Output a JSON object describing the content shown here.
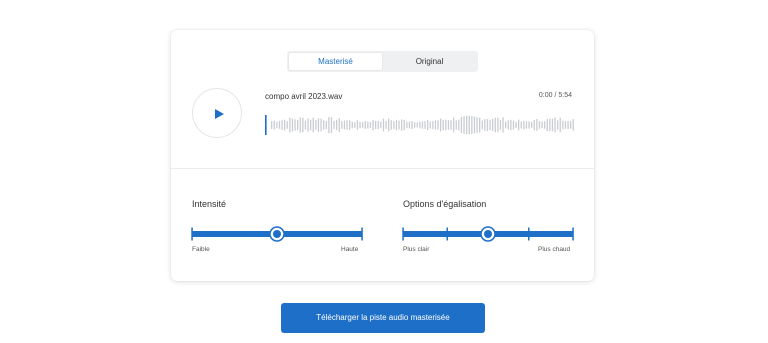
{
  "tabs": {
    "mastered": "Masterisé",
    "original": "Original"
  },
  "player": {
    "filename": "compo avril 2023.wav",
    "time": "0:00 / 5:54",
    "progress": 0
  },
  "intensity": {
    "title": "Intensité",
    "min_label": "Faible",
    "max_label": "Haute",
    "value": 0.5
  },
  "eq": {
    "title": "Options d'égalisation",
    "min_label": "Plus clair",
    "max_label": "Plus chaud",
    "value": 0.5
  },
  "download": {
    "label": "Télécharger la piste audio masterisée"
  },
  "colors": {
    "accent": "#1e6fc8",
    "waveform": "#c9ccd1"
  }
}
